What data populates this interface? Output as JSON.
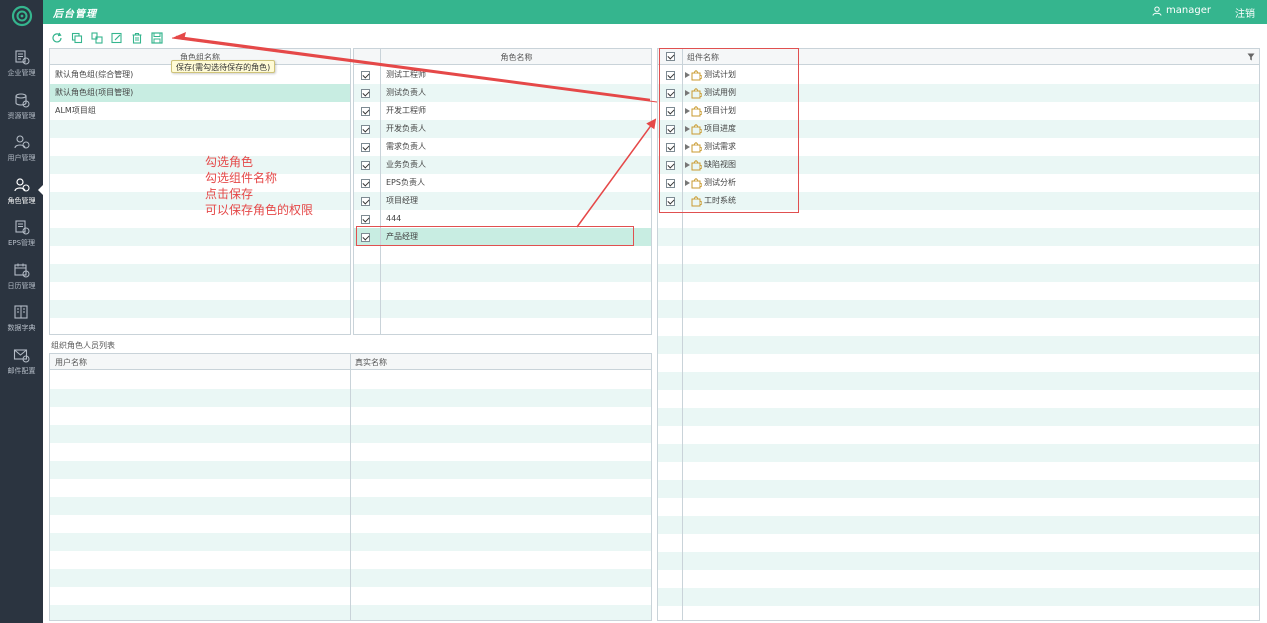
{
  "header": {
    "title": "后台管理",
    "user": "manager",
    "logout": "注销"
  },
  "sidebar": {
    "items": [
      {
        "label": "企业管理",
        "icon": "enterprise-icon"
      },
      {
        "label": "资源管理",
        "icon": "resource-icon"
      },
      {
        "label": "用户管理",
        "icon": "users-icon"
      },
      {
        "label": "角色管理",
        "icon": "role-icon",
        "active": true
      },
      {
        "label": "EPS管理",
        "icon": "eps-icon"
      },
      {
        "label": "日历管理",
        "icon": "calendar-icon"
      },
      {
        "label": "数据字典",
        "icon": "dictionary-icon"
      },
      {
        "label": "邮件配置",
        "icon": "mail-icon"
      }
    ]
  },
  "toolbar": {
    "buttons": [
      "refresh-icon",
      "copy-icon",
      "paste-icon",
      "edit-icon",
      "delete-icon",
      "save-icon"
    ],
    "tooltip": "保存(需勾选待保存的角色)"
  },
  "role_groups": {
    "header": "角色组名称",
    "rows": [
      "默认角色组(综合管理)",
      "默认角色组(项目管理)",
      "ALM项目组"
    ],
    "selected_index": 1
  },
  "roles": {
    "header": "角色名称",
    "rows": [
      "测试工程师",
      "测试负责人",
      "开发工程师",
      "开发负责人",
      "需求负责人",
      "业务负责人",
      "EPS负责人",
      "项目经理",
      "444",
      "产品经理"
    ],
    "selected_index": 9
  },
  "members": {
    "caption": "组织角色人员列表",
    "columns": [
      "用户名称",
      "真实名称"
    ]
  },
  "components": {
    "header": "组件名称",
    "rows": [
      {
        "label": "测试计划",
        "expandable": true
      },
      {
        "label": "测试用例",
        "expandable": true
      },
      {
        "label": "项目计划",
        "expandable": true
      },
      {
        "label": "项目进度",
        "expandable": true
      },
      {
        "label": "测试需求",
        "expandable": true
      },
      {
        "label": "缺陷视图",
        "expandable": true
      },
      {
        "label": "测试分析",
        "expandable": true
      },
      {
        "label": "工时系统",
        "expandable": false
      }
    ]
  },
  "annotation": {
    "lines": [
      "勾选角色",
      "勾选组件名称",
      "点击保存",
      "可以保存角色的权限"
    ],
    "color": "#e54848"
  },
  "colors": {
    "accent": "#35b58e",
    "sidebar": "#2b3440",
    "row_alt": "#eaf7f5",
    "row_selected": "#c8ede2"
  }
}
